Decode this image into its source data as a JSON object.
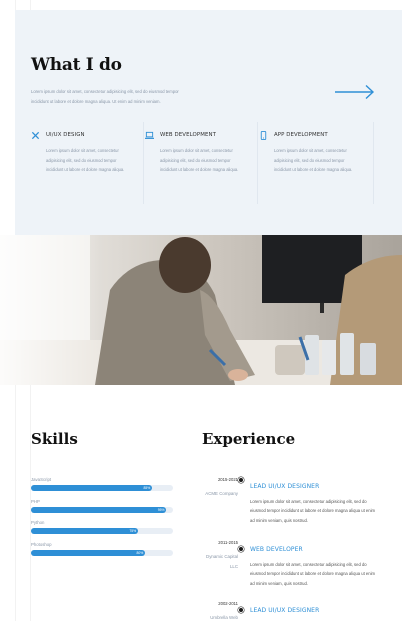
{
  "whatido": {
    "title": "What I do",
    "description": "Lorem ipsum dolor sit amet, consectetur adipisicing elit, sed do eiusmod tempor incididunt ut labore et dolore magna aliqua. Ut enim ad minim veniam.",
    "arrow_icon": "arrow-right-icon",
    "services": [
      {
        "icon": "tools-icon",
        "name": "UI/UX DESIGN",
        "text": "Lorem ipsum dolor sit amet, consectetur adipisicing elit, sed do eiusmod tempor incididunt ut labore et dolore magna aliqua."
      },
      {
        "icon": "laptop-icon",
        "name": "WEB DEVELOPMENT",
        "text": "Lorem ipsum dolor sit amet, consectetur adipisicing elit, sed do eiusmod tempor incididunt ut labore et dolore magna aliqua."
      },
      {
        "icon": "mobile-icon",
        "name": "APP DEVELOPMENT",
        "text": "Lorem ipsum dolor sit amet, consectetur adipisicing elit, sed do eiusmod tempor incididunt ut labore et dolore magna aliqua."
      }
    ]
  },
  "skills": {
    "title": "Skills",
    "items": [
      {
        "name": "JavaScript",
        "percent": 85,
        "percent_label": "85%"
      },
      {
        "name": "PHP",
        "percent": 95,
        "percent_label": "95%"
      },
      {
        "name": "Python",
        "percent": 75,
        "percent_label": "75%"
      },
      {
        "name": "Photoshop",
        "percent": 80,
        "percent_label": "80%"
      }
    ]
  },
  "experience": {
    "title": "Experience",
    "items": [
      {
        "date": "2015-2021",
        "company": "ACME Company",
        "role": "LEAD UI/UX DESIGNER",
        "desc": "Lorem ipsum dolor sit amet, consectetur adipisicing elit, sed do eiusmod tempor incididunt ut labore et dolore magna aliqua ut enim ad minim veniam, quis nostrud."
      },
      {
        "date": "2011-2015",
        "company": "Dynamic Capital LLC",
        "role": "WEB DEVELOPER",
        "desc": "Lorem ipsum dolor sit amet, consectetur adipisicing elit, sed do eiusmod tempor incididunt ut labore et dolore magna aliqua ut enim ad minim veniam, quis nostrud."
      },
      {
        "date": "2002-2011",
        "company": "Umbrella Web",
        "role": "LEAD UI/UX DESIGNER",
        "desc": ""
      }
    ]
  },
  "colors": {
    "accent": "#2e8fd6",
    "section_bg": "#eef3f8",
    "heading": "#111111",
    "muted_text": "#8a97a8"
  }
}
